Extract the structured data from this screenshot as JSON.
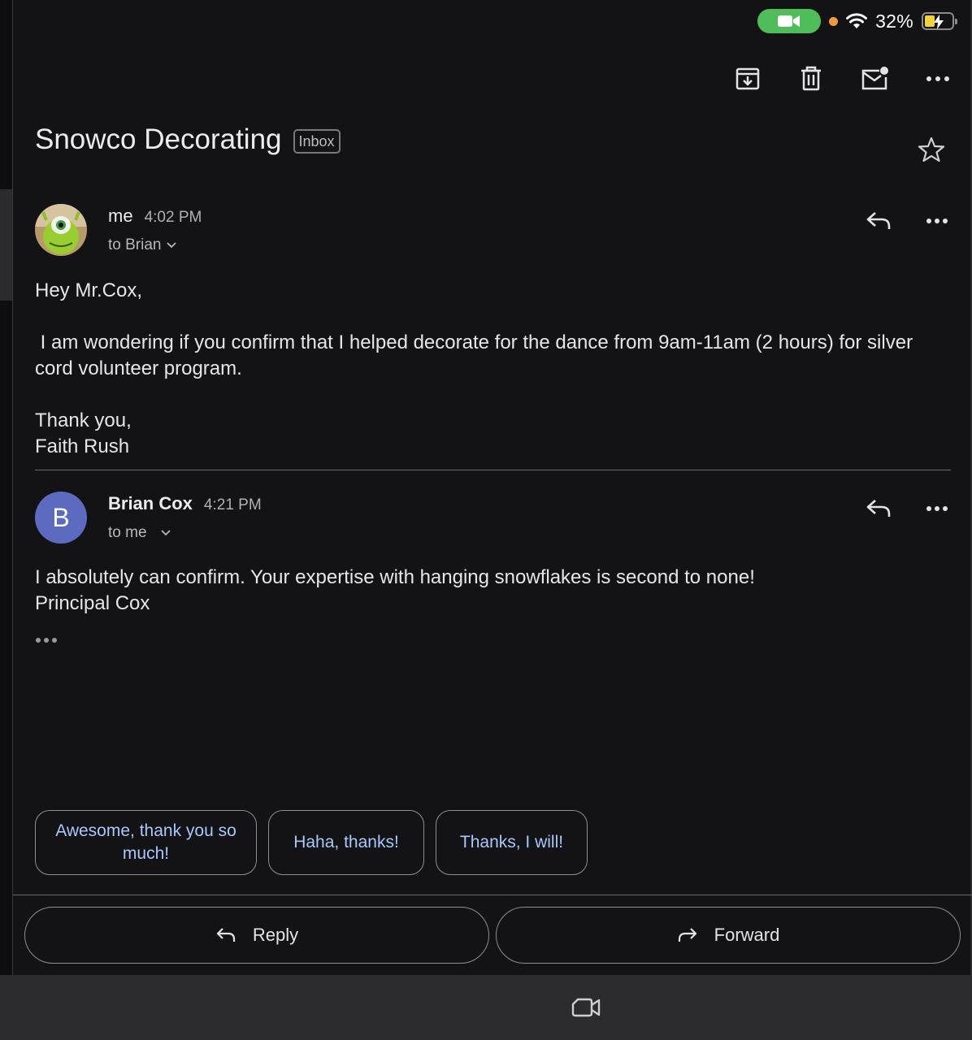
{
  "status_bar": {
    "battery_percent": "32%"
  },
  "toolbar": {
    "archive": "archive-icon",
    "delete": "trash-icon",
    "mark_unread": "mark-unread-icon",
    "more": "more-horizontal-icon"
  },
  "thread": {
    "subject": "Snowco Decorating",
    "label": "Inbox"
  },
  "messages": [
    {
      "sender": "me",
      "time": "4:02 PM",
      "recipients": "to Brian",
      "body": [
        "Hey Mr.Cox,",
        " I am wondering if you confirm that I helped decorate for the dance from 9am-11am (2 hours) for silver cord volunteer program.",
        "Thank you,",
        "Faith Rush"
      ]
    },
    {
      "sender": "Brian Cox",
      "avatar_letter": "B",
      "time": "4:21 PM",
      "recipients": "to me",
      "body": [
        "I absolutely can confirm. Your expertise with hanging snowflakes is second to none!",
        "Principal Cox"
      ]
    }
  ],
  "smart_replies": [
    "Awesome, thank you so much!",
    "Haha, thanks!",
    "Thanks, I will!"
  ],
  "actions": {
    "reply": "Reply",
    "forward": "Forward"
  },
  "colors": {
    "background": "#131316",
    "accent_text": "#a8c7fa",
    "avatar_b": "#5c6bc0",
    "facetime_green": "#4fbd5a"
  }
}
